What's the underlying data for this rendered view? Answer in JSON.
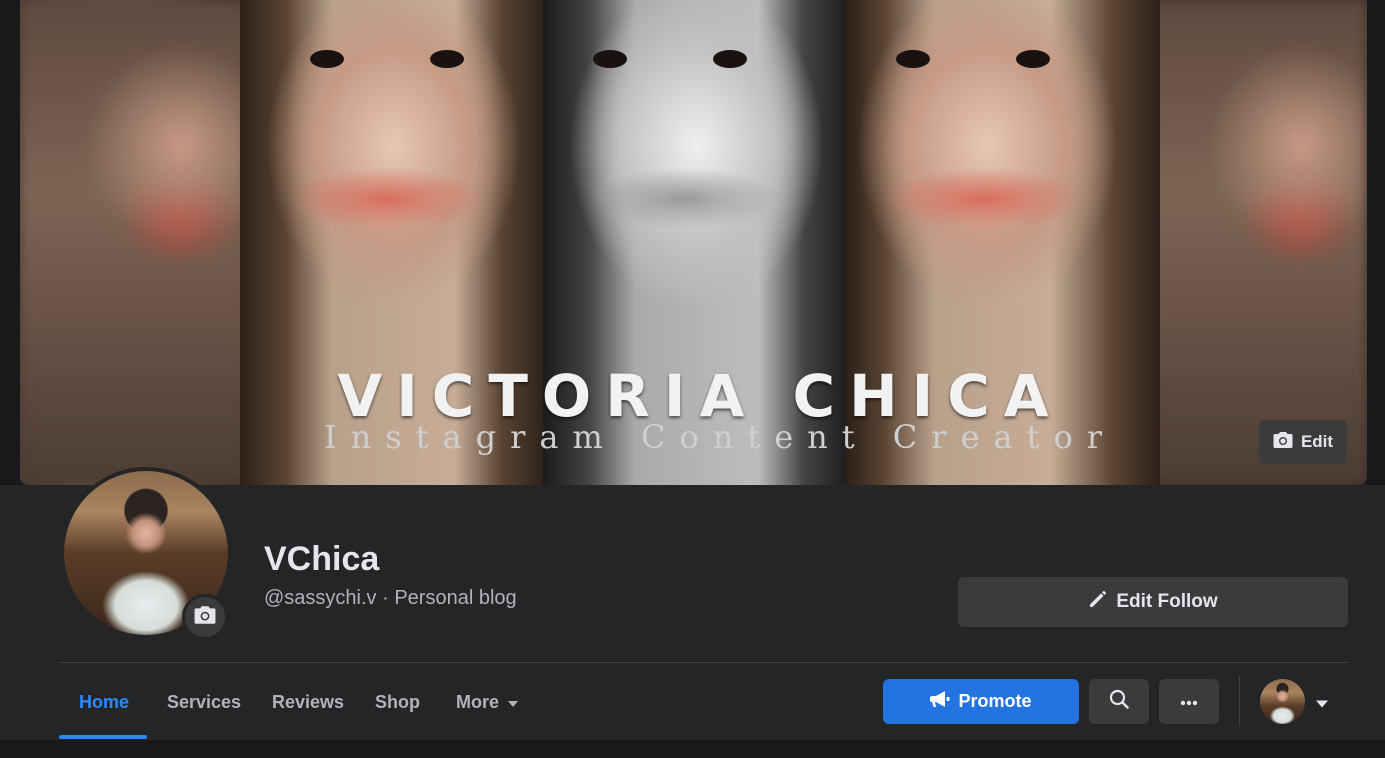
{
  "cover": {
    "title_text": "VICTORIA CHICA",
    "subtitle_text": "Instagram Content Creator",
    "edit_label": "Edit"
  },
  "page": {
    "name": "VChica",
    "handle_line": "@sassychi.v · Personal blog"
  },
  "actions": {
    "edit_follow_label": "Edit Follow",
    "promote_label": "Promote"
  },
  "tabs": [
    {
      "label": "Home",
      "active": true
    },
    {
      "label": "Services"
    },
    {
      "label": "Reviews"
    },
    {
      "label": "Shop"
    },
    {
      "label": "More"
    }
  ],
  "icons": {
    "camera": "camera-icon",
    "pencil": "pencil-icon",
    "megaphone": "megaphone-icon",
    "search": "search-icon",
    "more": "ellipsis-icon",
    "caret": "caret-down-icon"
  },
  "colors": {
    "accent": "#2d88ff",
    "promote": "#2374e1",
    "surface": "#242526",
    "button": "#3a3b3c",
    "background": "#18191a"
  }
}
